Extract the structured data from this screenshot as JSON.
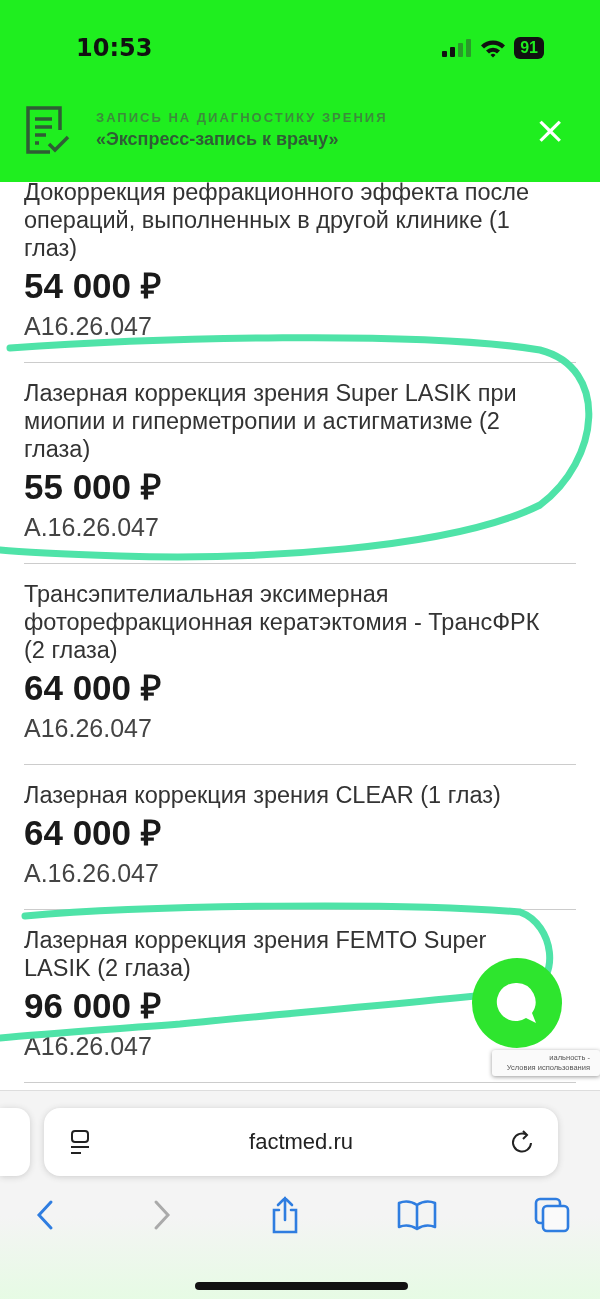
{
  "status_bar": {
    "time": "10:53",
    "battery": "91"
  },
  "banner": {
    "eyebrow": "ЗАПИСЬ НА ДИАГНОСТИКУ ЗРЕНИЯ",
    "title": "«Экспресс-запись к врачу»",
    "close": "×"
  },
  "services": [
    {
      "name": "Докоррекция рефракционного эффекта после операций, выполненных в другой клинике (1 глаз)",
      "price": "54 000 ₽",
      "code": "A16.26.047"
    },
    {
      "name": "Лазерная коррекция зрения Super LASIK при миопии и гиперметропии и астигматизме (2 глаза)",
      "price": "55 000 ₽",
      "code": "A.16.26.047"
    },
    {
      "name": "Трансэпителиальная эксимерная фоторефракционная кератэктомия - ТрансФРК (2 глаза)",
      "price": "64 000 ₽",
      "code": "A16.26.047"
    },
    {
      "name": "Лазерная коррекция зрения CLEAR (1 глаз)",
      "price": "64 000 ₽",
      "code": "A.16.26.047"
    },
    {
      "name": "Лазерная коррекция зрения FEMTO Super LASIK (2 глаза)",
      "price": "96 000 ₽",
      "code": "A16.26.047"
    }
  ],
  "recaptcha": {
    "line_1": "иальность -",
    "line_2": "Условия использования"
  },
  "browser": {
    "url": "factmed.ru"
  }
}
